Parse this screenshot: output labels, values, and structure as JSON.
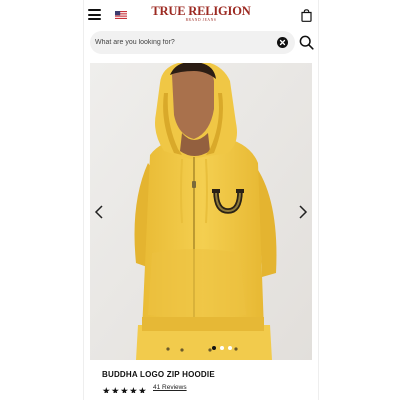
{
  "header": {
    "menu_icon": "hamburger-icon",
    "flag_icon": "us-flag-icon",
    "brand_name": "TRUE RELIGION",
    "brand_tagline": "BRAND JEANS",
    "bag_icon": "shopping-bag-icon"
  },
  "search": {
    "placeholder": "What are you looking for?",
    "value": "",
    "clear_icon": "clear-x-icon",
    "search_icon": "magnifier-icon"
  },
  "carousel": {
    "prev_icon": "chevron-left-icon",
    "next_icon": "chevron-right-icon",
    "image": "model-wearing-yellow-hoodie",
    "dots_count": 3,
    "active_dot": 0
  },
  "product": {
    "title": "BUDDHA LOGO ZIP HOODIE",
    "rating": 5,
    "reviews_label": "41 Reviews"
  },
  "colors": {
    "brand": "#9c2a22",
    "hoodie": "#f2cb49",
    "background": "#e9e7e4"
  }
}
